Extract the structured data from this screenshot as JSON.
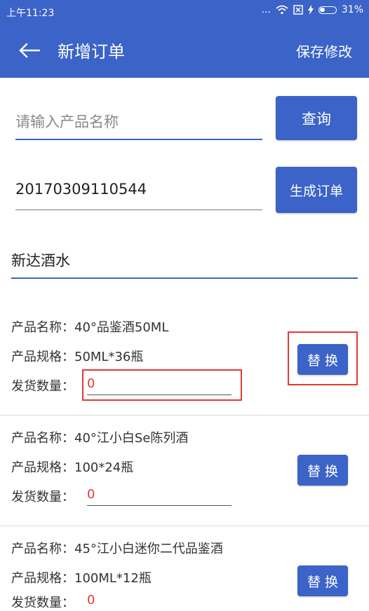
{
  "status_bar": {
    "time": "上午11:23",
    "signal": "...",
    "battery_percent": "31%"
  },
  "app_bar": {
    "title": "新增订单",
    "save_label": "保存修改"
  },
  "search": {
    "placeholder": "请输入产品名称",
    "query_button": "查询"
  },
  "order": {
    "number": "20170309110544",
    "generate_button": "生成订单"
  },
  "customer": {
    "name": "新达酒水"
  },
  "products": [
    {
      "name_label": "产品名称：",
      "name": "40°品鉴酒50ML",
      "spec_label": "产品规格：",
      "spec": "50ML*36瓶",
      "qty_label": "发货数量：",
      "qty": "0",
      "replace_button": "替 换"
    },
    {
      "name_label": "产品名称：",
      "name": "40°江小白Se陈列酒",
      "spec_label": "产品规格：",
      "spec": "100*24瓶",
      "qty_label": "发货数量：",
      "qty": "0",
      "replace_button": "替 换"
    },
    {
      "name_label": "产品名称：",
      "name": "45°江小白迷你二代品鉴酒",
      "spec_label": "产品规格：",
      "spec": "100ML*12瓶",
      "qty_label": "发货数量：",
      "qty": "0",
      "replace_button": "替 换"
    }
  ],
  "colors": {
    "primary": "#3b63c8",
    "highlight": "#e53935"
  }
}
